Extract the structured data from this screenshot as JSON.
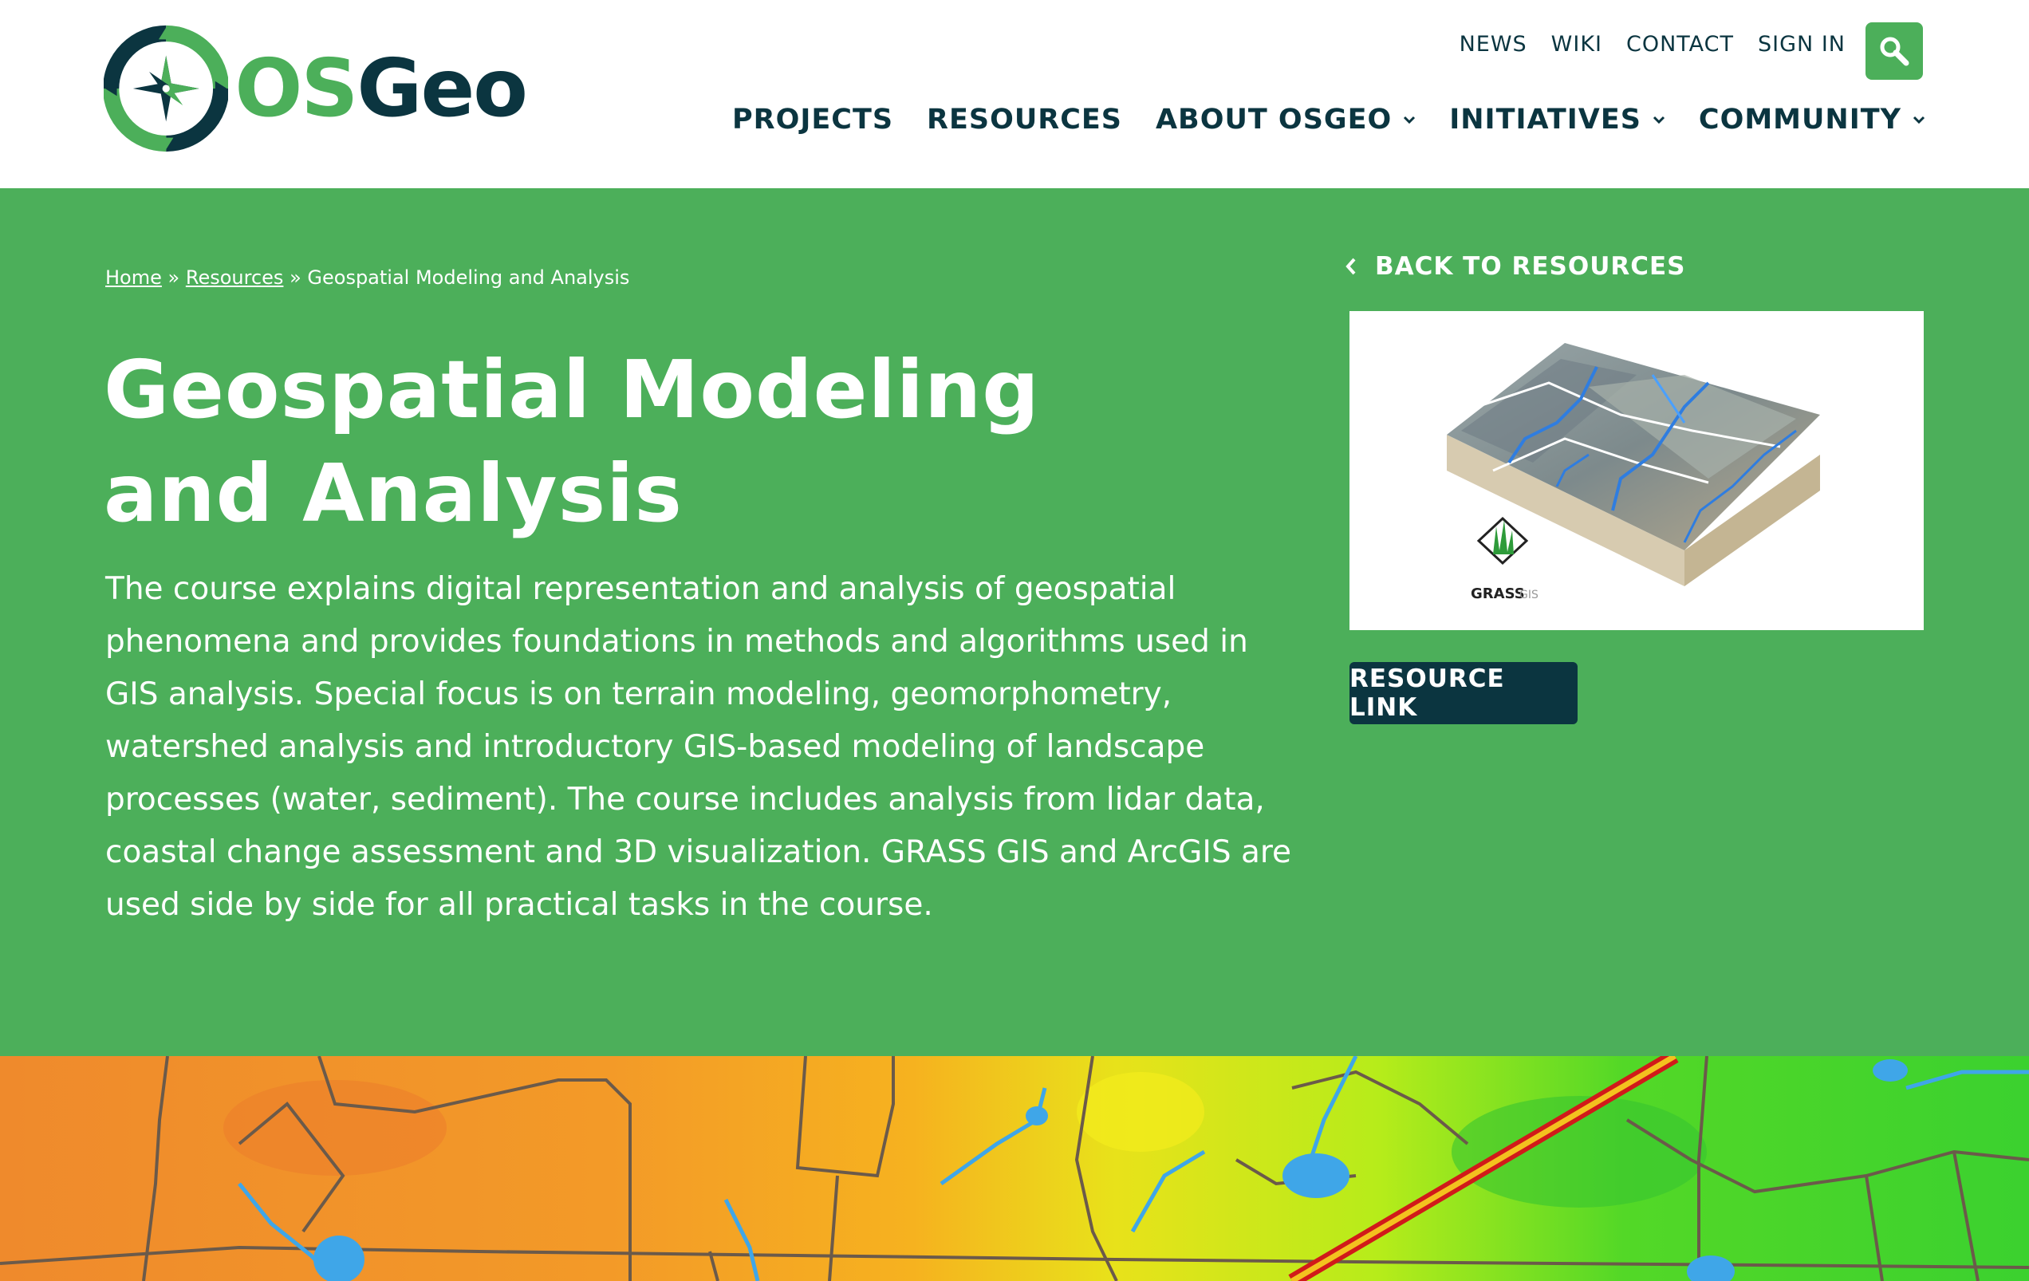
{
  "brand": {
    "os": "OS",
    "geo": "Geo",
    "colors": {
      "green": "#4caf5a",
      "navy": "#0b3540"
    }
  },
  "util_nav": {
    "news": "NEWS",
    "wiki": "WIKI",
    "contact": "CONTACT",
    "sign_in": "SIGN IN"
  },
  "main_nav": {
    "projects": "PROJECTS",
    "resources": "RESOURCES",
    "about": "ABOUT OSGEO",
    "initiatives": "INITIATIVES",
    "community": "COMMUNITY"
  },
  "breadcrumb": {
    "home": "Home",
    "sep": "»",
    "resources": "Resources",
    "current": "Geospatial Modeling and Analysis"
  },
  "page": {
    "title": "Geospatial Modeling and Analysis",
    "description": "The course explains digital representation and analysis of geospatial phenomena and provides foundations in methods and algorithms used in GIS analysis. Special focus is on terrain modeling, geomorphometry, watershed analysis and introductory GIS-based modeling of landscape processes (water, sediment). The course includes analysis from lidar data, coastal change assessment and 3D visualization. GRASS GIS and ArcGIS are used side by side for all practical tasks in the course.",
    "back_label": "BACK TO RESOURCES",
    "resource_link_label": "RESOURCE LINK",
    "thumbnail_logo_text": "GRASS",
    "thumbnail_logo_sub": "GIS"
  },
  "icons": {
    "search": "search-icon",
    "chevron_down": "chevron-down-icon",
    "chevron_left": "chevron-left-icon",
    "compass": "compass-logo-icon"
  }
}
